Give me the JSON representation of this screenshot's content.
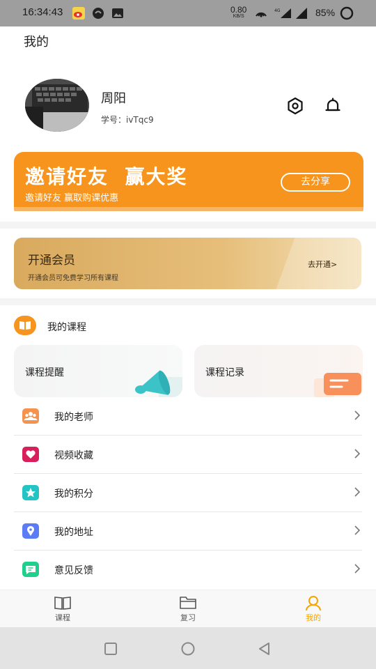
{
  "status_bar": {
    "time": "16:34:43",
    "net_speed": "0.80",
    "net_unit": "KB/S",
    "network": "4G",
    "battery": "85%"
  },
  "header": {
    "title": "我的"
  },
  "profile": {
    "name": "周阳",
    "student_id": "学号：ivTqc9"
  },
  "invite_banner": {
    "title": "邀请好友  赢大奖",
    "subtitle": "邀请好友 赢取购课优惠",
    "button": "去分享",
    "color": "#f7941d"
  },
  "membership": {
    "title": "开通会员",
    "subtitle": "开通会员可免费学习所有课程",
    "link": "去开通>"
  },
  "my_courses": {
    "title": "我的课程",
    "cards": [
      {
        "label": "课程提醒"
      },
      {
        "label": "课程记录"
      }
    ]
  },
  "menu": [
    {
      "label": "我的老师",
      "icon": "users-icon",
      "color": "#f5924e"
    },
    {
      "label": "视频收藏",
      "icon": "heart-icon",
      "color": "#d81e5b"
    },
    {
      "label": "我的积分",
      "icon": "star-icon",
      "color": "#25c4c4"
    },
    {
      "label": "我的地址",
      "icon": "location-pin-icon",
      "color": "#5b7cf5"
    },
    {
      "label": "意见反馈",
      "icon": "chat-bubble-icon",
      "color": "#1fcf8c"
    }
  ],
  "tabs": [
    {
      "label": "课程",
      "icon": "book-icon"
    },
    {
      "label": "复习",
      "icon": "folder-icon"
    },
    {
      "label": "我的",
      "icon": "person-icon",
      "active": true
    }
  ],
  "accent_color": "#f5a400"
}
